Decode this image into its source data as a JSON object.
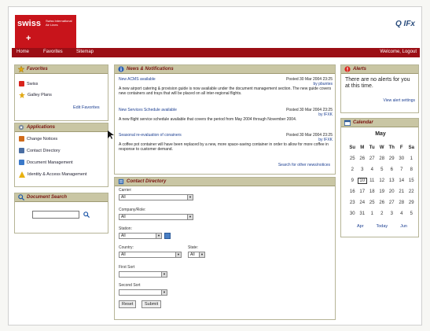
{
  "header": {
    "brand": "swiss",
    "brand_sub": "Swiss International Air Lines",
    "ifx": "Q IFx",
    "menu": [
      "Home",
      "Favorites",
      "Sitemap"
    ],
    "welcome": "Welcome, Logout"
  },
  "favorites": {
    "title": "Favorites",
    "items": [
      "Swiss",
      "Galley Plans"
    ],
    "edit": "Edit Favorites"
  },
  "applications": {
    "title": "Applications",
    "items": [
      "Change Notices",
      "Contact Directory",
      "Document Management",
      "Identity & Access Management"
    ]
  },
  "doc_search": {
    "title": "Document Search"
  },
  "news": {
    "title": "News & Notifications",
    "items": [
      {
        "headline": "New ACMS available",
        "date": "Posted 30 Mar 2004 23:25",
        "by": "by pbuntes",
        "body": "A new airport catering & provision guide is now available under the document management section. The new guide covers new containers and trays that will be placed on all inter-regional flights."
      },
      {
        "headline": "New Services Schedule available",
        "date": "Posted 30 Mar 2004 23:25",
        "by": "by IFXK",
        "body": "A new flight service schedule available that covers the period from May 2004 through November 2004."
      },
      {
        "headline": "Seasonal re-evaluation of conainers",
        "date": "Posted 30 Mar 2004 23:25",
        "by": "by IFXK",
        "body": "A coffee pot container will have been replaced by a new, more space-saving container in order to allow for more coffee in response to customer demand."
      }
    ],
    "search_link": "Search for other news/notices"
  },
  "alerts": {
    "title": "Alerts",
    "message": "There are no alerts for you at this time.",
    "link": "View alert settings"
  },
  "calendar": {
    "title": "Calendar",
    "month": "May",
    "days": [
      "Su",
      "M",
      "Tu",
      "W",
      "Th",
      "F",
      "Sa"
    ],
    "weeks": [
      [
        "25",
        "26",
        "27",
        "28",
        "29",
        "30",
        "1"
      ],
      [
        "2",
        "3",
        "4",
        "5",
        "6",
        "7",
        "8"
      ],
      [
        "9",
        "10",
        "11",
        "12",
        "13",
        "14",
        "15"
      ],
      [
        "16",
        "17",
        "18",
        "19",
        "20",
        "21",
        "22"
      ],
      [
        "23",
        "24",
        "25",
        "26",
        "27",
        "28",
        "29"
      ],
      [
        "30",
        "31",
        "1",
        "2",
        "3",
        "4",
        "5"
      ]
    ],
    "nav": [
      "Apr",
      "Today",
      "Jun"
    ]
  },
  "contact_dir": {
    "title": "Contact Directory",
    "fields": {
      "carrier": {
        "label": "Carrier:",
        "value": "All"
      },
      "company_role": {
        "label": "Company/Role:",
        "value": "All"
      },
      "station": {
        "label": "Station:",
        "value": "All"
      },
      "country": {
        "label": "Country:",
        "value": "All"
      },
      "state": {
        "label": "State:",
        "value": "All"
      },
      "first_sort": {
        "label": "First Sort",
        "value": ""
      },
      "second_sort": {
        "label": "Second Sort",
        "value": ""
      }
    },
    "reset": "Reset",
    "submit": "Submit"
  }
}
